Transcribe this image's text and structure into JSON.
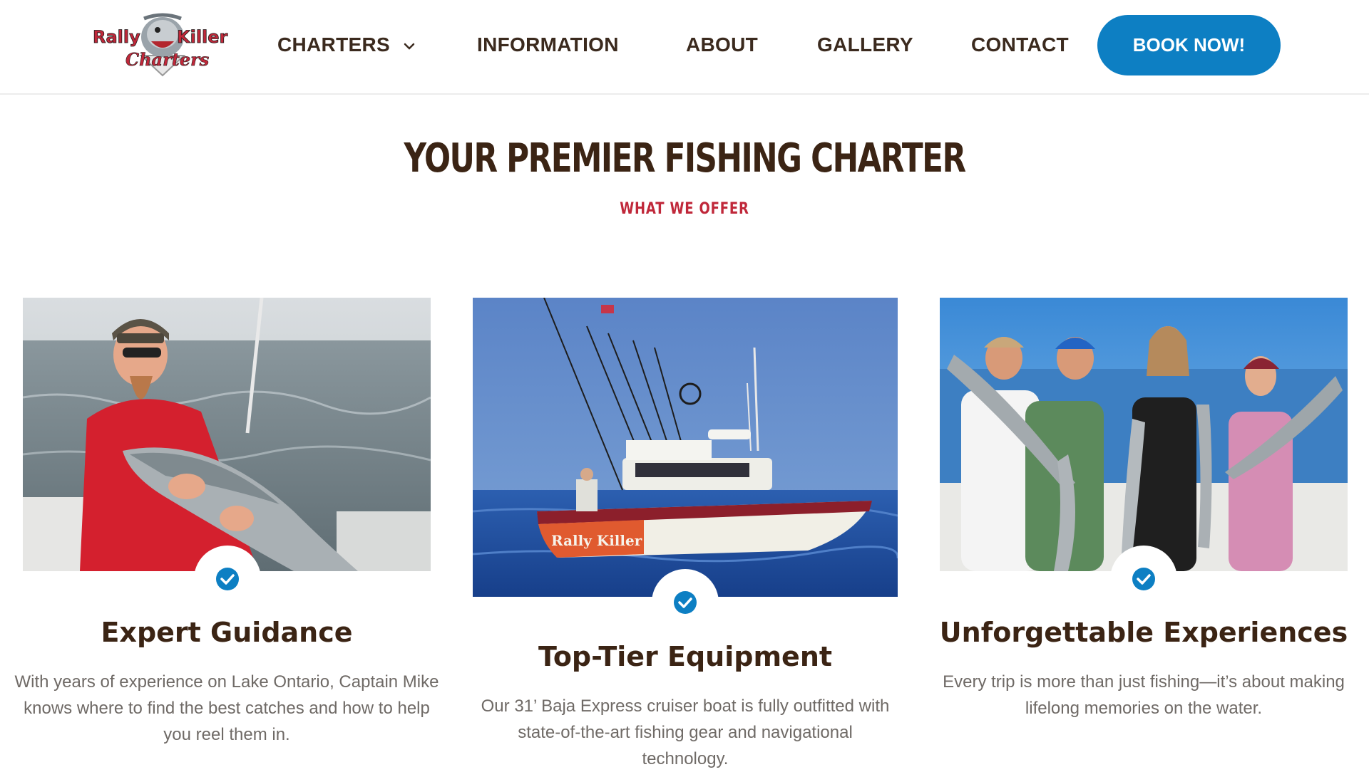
{
  "header": {
    "logo": {
      "line1": "Rally",
      "line2": "Killer",
      "line3": "Charters"
    },
    "nav": [
      {
        "label": "CHARTERS",
        "has_dropdown": true
      },
      {
        "label": "INFORMATION"
      },
      {
        "label": "ABOUT"
      },
      {
        "label": "GALLERY"
      },
      {
        "label": "CONTACT"
      }
    ],
    "cta_label": "BOOK NOW!"
  },
  "section": {
    "title": "YOUR PREMIER FISHING CHARTER",
    "subtitle": "WHAT WE OFFER"
  },
  "cards": [
    {
      "title": "Expert Guidance",
      "text": "With years of experience on Lake Ontario, Captain Mike knows where to find the best catches and how to help you reel them in.",
      "image": "captain-holding-salmon-photo",
      "icon": "check-circle-icon"
    },
    {
      "title": "Top-Tier Equipment",
      "text": "Our 31’ Baja Express cruiser boat is fully outfitted with state-of-the-art fishing gear and navigational technology.",
      "image": "charter-boat-photo",
      "boat_name": "Rally Killer",
      "icon": "check-circle-icon"
    },
    {
      "title": "Unforgettable Experiences",
      "text": "Every trip is more than just fishing—it’s about making lifelong memories on the water.",
      "image": "group-with-catch-photo",
      "icon": "check-circle-icon"
    }
  ],
  "colors": {
    "accent_blue": "#0d7fc3",
    "heading_brown": "#3b2414",
    "subtitle_red": "#c0283a",
    "body_gray": "#6f6a66"
  }
}
